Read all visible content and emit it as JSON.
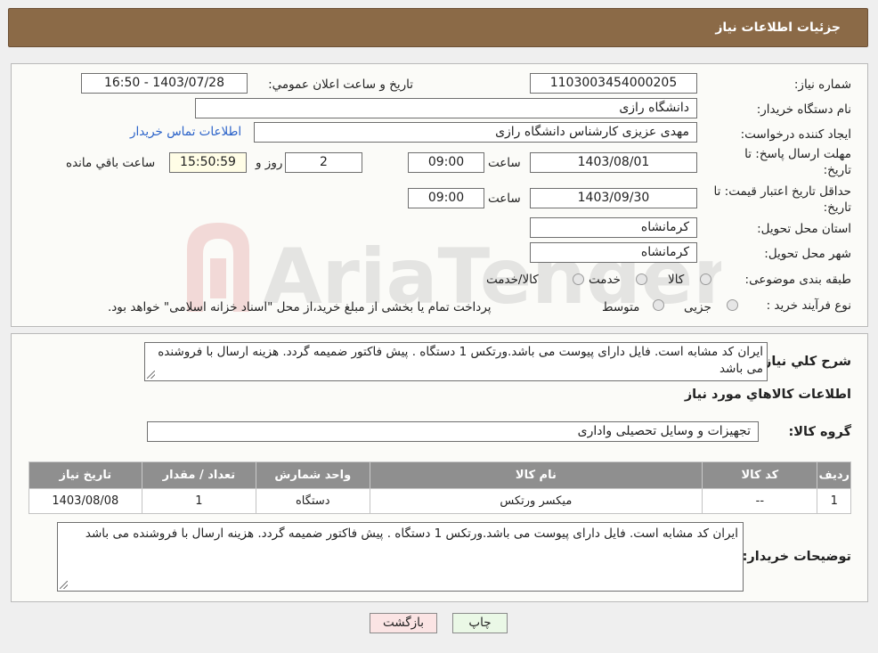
{
  "header": {
    "title": "جزئیات اطلاعات نیاز"
  },
  "form": {
    "need_number_label": "شماره نیاز:",
    "need_number": "1103003454000205",
    "announce_label": "تاريخ و ساعت اعلان عمومي:",
    "announce_value": "1403/07/28 - 16:50",
    "buyer_org_label": "نام دستگاه خریدار:",
    "buyer_org": "دانشگاه رازی",
    "creator_label": "ایجاد کننده درخواست:",
    "creator": "مهدی عزیزی کارشناس دانشگاه رازی",
    "contact_link": "اطلاعات تماس خریدار",
    "deadline_label_1": "مهلت ارسال پاسخ: تا",
    "deadline_label_2": "تاریخ:",
    "deadline_date": "1403/08/01",
    "time_label": "ساعت",
    "deadline_time": "09:00",
    "days_value": "2",
    "days_label": "روز و",
    "remaining_time": "15:50:59",
    "remaining_label": "ساعت باقي مانده",
    "validity_label_1": "حداقل تاریخ اعتبار قیمت: تا",
    "validity_label_2": "تاریخ:",
    "validity_date": "1403/09/30",
    "validity_time": "09:00",
    "province_label": "استان محل تحویل:",
    "province": "کرمانشاه",
    "city_label": "شهر محل تحویل:",
    "city": "کرمانشاه",
    "category_label": "طبقه بندی موضوعی:",
    "category_options": [
      "کالا",
      "خدمت",
      "کالا/خدمت"
    ],
    "purchase_label": "نوع فرآیند خرید :",
    "purchase_options": [
      "جزیی",
      "متوسط"
    ],
    "purchase_note": "پرداخت تمام یا بخشی از مبلغ خرید،از محل \"اسناد خزانه اسلامی\" خواهد بود."
  },
  "description": {
    "label": "شرح کلي نياز:",
    "text": "ایران کد مشابه است. فایل دارای پیوست می باشد.ورتکس 1 دستگاه . پیش فاکتور ضمیمه گردد. هزینه ارسال با فروشنده می باشد"
  },
  "goods": {
    "section_title": "اطلاعات کالاهاي مورد نياز",
    "group_label": "گروه کالا:",
    "group_value": "تجهیزات و وسایل تحصیلی واداری",
    "columns": [
      "رديف",
      "کد کالا",
      "نام کالا",
      "واحد شمارش",
      "تعداد / مقدار",
      "تاريخ نياز"
    ],
    "rows": [
      [
        "1",
        "--",
        "میکسر ورتکس",
        "دستگاه",
        "1",
        "1403/08/08"
      ]
    ]
  },
  "buyer_notes": {
    "label": "توضیحات خریدار:",
    "text": "ایران کد مشابه است. فایل دارای پیوست می باشد.ورتکس 1 دستگاه . پیش فاکتور ضمیمه گردد. هزینه ارسال با فروشنده می باشد"
  },
  "buttons": {
    "print": "چاپ",
    "back": "بازگشت"
  },
  "watermark": "AriaTender.neT",
  "colors": {
    "header": "#8b6a47",
    "table_header": "#8f8f8f",
    "link": "#2a62c9",
    "print_btn": "#eaf8e6",
    "back_btn": "#fbe4e4"
  }
}
